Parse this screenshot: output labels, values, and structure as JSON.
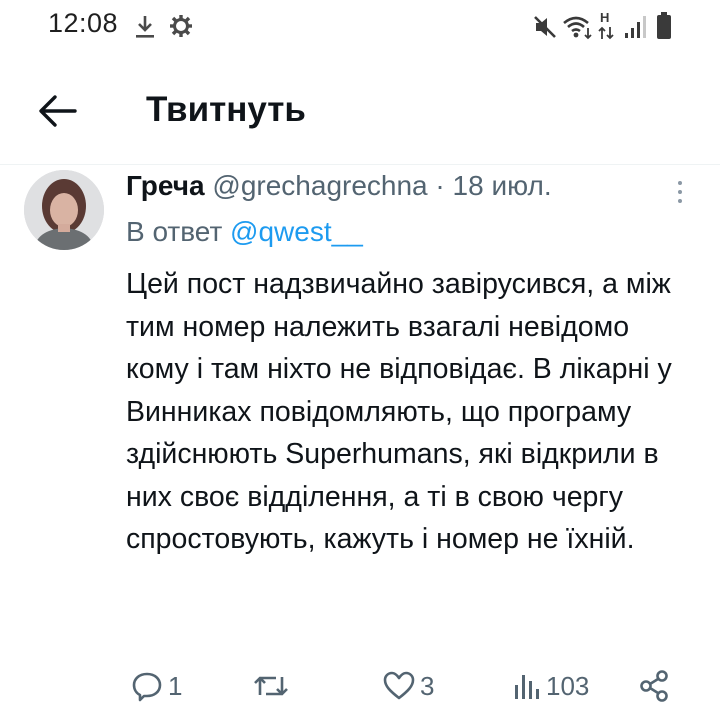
{
  "status_bar": {
    "time": "12:08",
    "icons": [
      "download-icon",
      "settings-gear-icon",
      "mute-icon",
      "wifi-icon",
      "data-arrows-icon",
      "signal-icon",
      "battery-icon"
    ],
    "network_label": "H"
  },
  "header": {
    "title": "Твитнуть",
    "back_icon": "arrow-left-icon"
  },
  "tweet": {
    "author_name": "Греча",
    "handle": "@grechagrechna",
    "separator": "·",
    "date": "18 июл.",
    "reply_prefix": "В ответ",
    "reply_to": "@qwest__",
    "text": "Цей пост надзвичайно завірусився, а між тим номер належить взагалі невідомо кому і там ніхто не відповідає. В лікарні у Винниках повідомляють, що програму здійснюють Superhumans, які відкрили в них своє відділення, а ті в свою чергу спростовують, кажуть і номер не їхній."
  },
  "actions": {
    "reply_count": "1",
    "retweet_count": "",
    "like_count": "3",
    "views_count": "103",
    "icons": [
      "reply-icon",
      "retweet-icon",
      "like-icon",
      "views-icon",
      "share-icon"
    ]
  },
  "colors": {
    "text_primary": "#0f1419",
    "text_secondary": "#536471",
    "link": "#1d9bf0",
    "divider": "#eff3f4"
  }
}
